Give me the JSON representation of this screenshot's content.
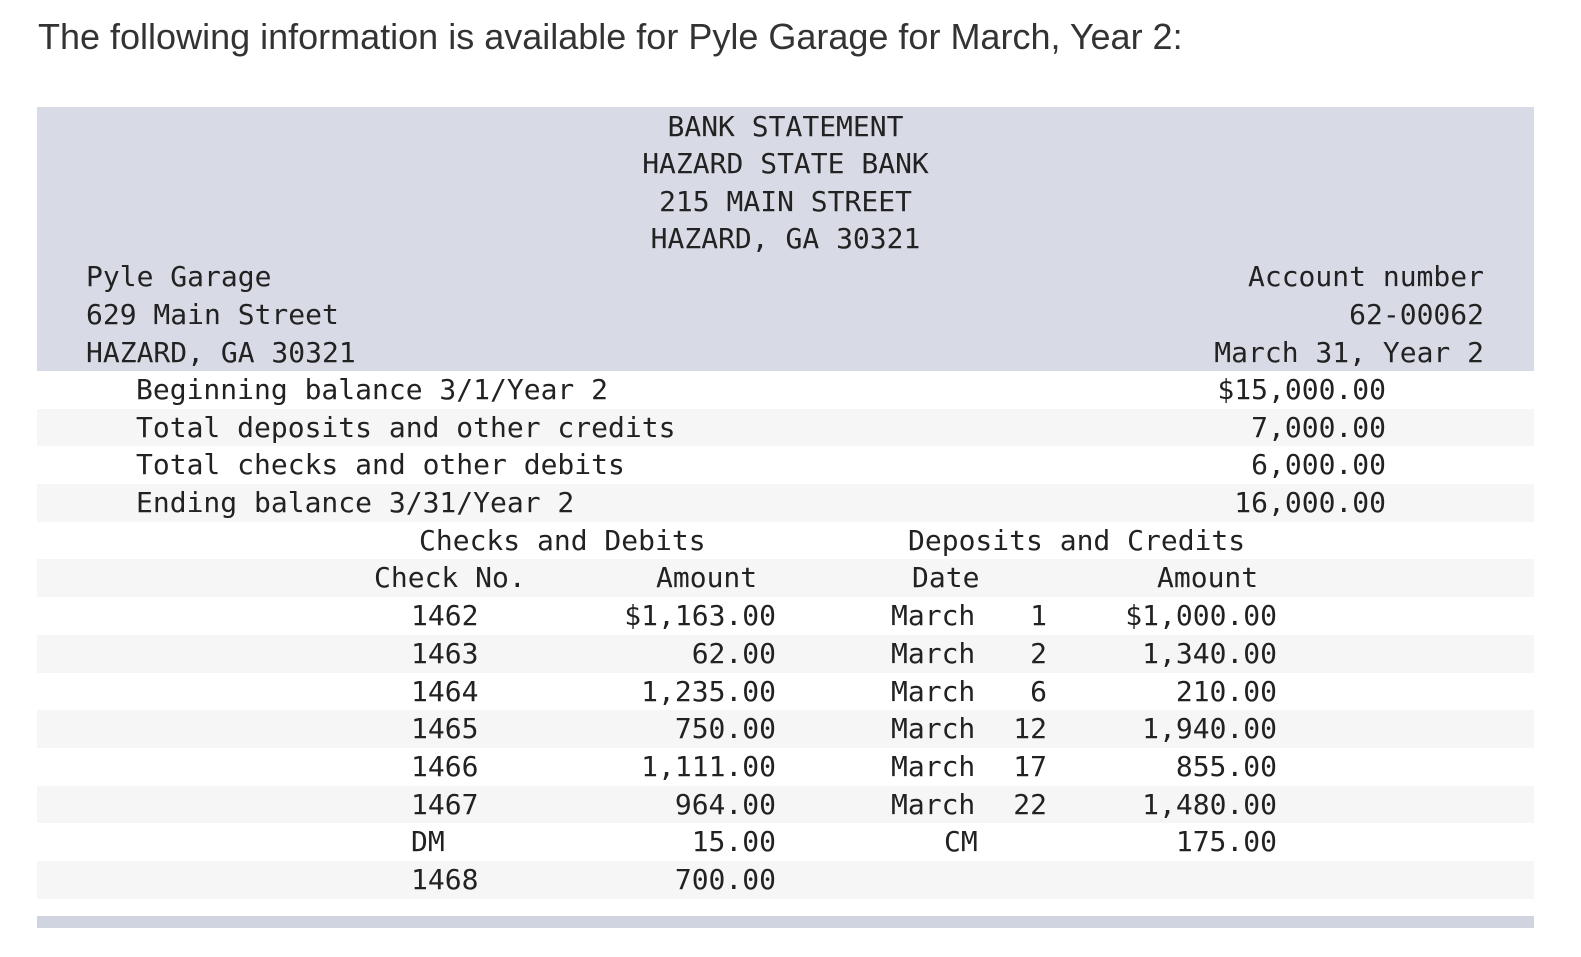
{
  "intro": "The following information is available for Pyle Garage for March, Year 2:",
  "bank": {
    "title": "BANK STATEMENT",
    "name": "HAZARD STATE BANK",
    "street": "215 MAIN STREET",
    "city": "HAZARD, GA 30321"
  },
  "customer": {
    "name": "Pyle Garage",
    "street": "629 Main Street",
    "city": "HAZARD, GA 30321"
  },
  "account": {
    "label": "Account number",
    "number": "62-00062",
    "date": "March 31, Year 2"
  },
  "summary": [
    {
      "label": "Beginning balance 3/1/Year 2",
      "value": "$15,000.00"
    },
    {
      "label": "Total deposits and other credits",
      "value": "7,000.00"
    },
    {
      "label": "Total checks and other debits",
      "value": "6,000.00"
    },
    {
      "label": "Ending balance 3/31/Year 2",
      "value": "16,000.00"
    }
  ],
  "sections": {
    "checks_title": "Checks and Debits",
    "deposits_title": "Deposits and Credits"
  },
  "columns": {
    "check_no": "Check No.",
    "check_amount": "Amount",
    "date": "Date",
    "deposit_amount": "Amount"
  },
  "checks": [
    {
      "no": "1462",
      "amount": "$1,163.00"
    },
    {
      "no": "1463",
      "amount": "62.00"
    },
    {
      "no": "1464",
      "amount": "1,235.00"
    },
    {
      "no": "1465",
      "amount": "750.00"
    },
    {
      "no": "1466",
      "amount": "1,111.00"
    },
    {
      "no": "1467",
      "amount": "964.00"
    },
    {
      "no": "DM",
      "amount": "15.00"
    },
    {
      "no": "1468",
      "amount": "700.00"
    }
  ],
  "deposits": [
    {
      "month": "March",
      "day": "1",
      "amount": "$1,000.00"
    },
    {
      "month": "March",
      "day": "2",
      "amount": "1,340.00"
    },
    {
      "month": "March",
      "day": "6",
      "amount": "210.00"
    },
    {
      "month": "March",
      "day": "12",
      "amount": "1,940.00"
    },
    {
      "month": "March",
      "day": "17",
      "amount": "855.00"
    },
    {
      "month": "March",
      "day": "22",
      "amount": "1,480.00"
    },
    {
      "month": "CM",
      "day": "",
      "amount": "175.00"
    }
  ]
}
